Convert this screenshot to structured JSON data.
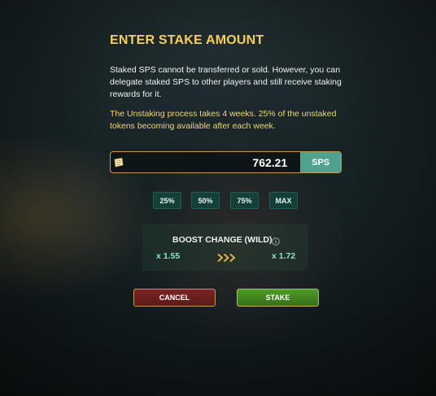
{
  "modal": {
    "title": "ENTER STAKE AMOUNT",
    "description": "Staked SPS cannot be transferred or sold. However, you can delegate staked SPS to other players and still receive staking rewards for it.",
    "warning": "The Unstaking process takes 4 weeks. 25% of the unstaked tokens becoming available after each week."
  },
  "amount": {
    "value": "762.21",
    "unit": "SPS",
    "icon": "sps-token-icon"
  },
  "percent_buttons": [
    "25%",
    "50%",
    "75%",
    "MAX"
  ],
  "boost": {
    "title": "BOOST CHANGE (WILD)",
    "from": "x 1.55",
    "to": "x 1.72",
    "arrow_icon": "triple-chevron-right-icon",
    "info_icon": "info-icon"
  },
  "actions": {
    "cancel": "CANCEL",
    "stake": "STAKE"
  },
  "colors": {
    "title": "#f4cf5f",
    "warning": "#f0d57a",
    "unit_bg": "#4fa28d",
    "cancel_bg": "#6b1f1f",
    "stake_bg": "#45871f",
    "multiplier": "#8fe3c6"
  }
}
